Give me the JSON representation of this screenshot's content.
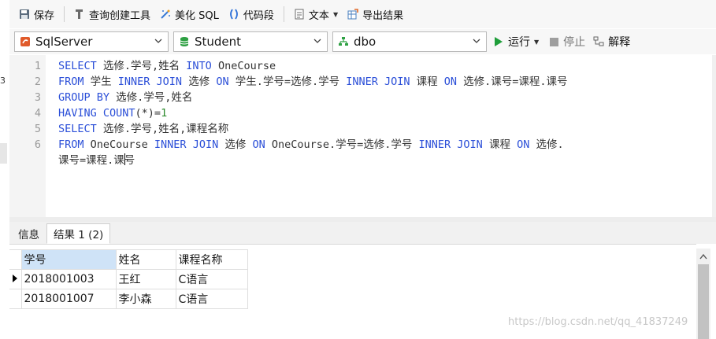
{
  "toolbar": {
    "save": "保存",
    "query_builder": "查询创建工具",
    "beautify_sql": "美化 SQL",
    "code_snippet": "代码段",
    "text": "文本",
    "export_result": "导出结果"
  },
  "selectors": {
    "connection": "SqlServer",
    "database": "Student",
    "schema": "dbo",
    "run": "运行",
    "stop": "停止",
    "explain": "解释"
  },
  "editor": {
    "line_numbers": [
      "1",
      "2",
      "3",
      "4",
      "5",
      "6"
    ],
    "lines": [
      [
        {
          "t": "kw",
          "v": "SELECT"
        },
        {
          "t": "tx",
          "v": " 选修.学号,姓名 "
        },
        {
          "t": "kw",
          "v": "INTO"
        },
        {
          "t": "tx",
          "v": " OneCourse"
        }
      ],
      [
        {
          "t": "kw",
          "v": "FROM"
        },
        {
          "t": "tx",
          "v": " 学生 "
        },
        {
          "t": "kw",
          "v": "INNER JOIN"
        },
        {
          "t": "tx",
          "v": " 选修 "
        },
        {
          "t": "kw",
          "v": "ON"
        },
        {
          "t": "tx",
          "v": " 学生.学号=选修.学号 "
        },
        {
          "t": "kw",
          "v": "INNER JOIN"
        },
        {
          "t": "tx",
          "v": " 课程 "
        },
        {
          "t": "kw",
          "v": "ON"
        },
        {
          "t": "tx",
          "v": " 选修.课号=课程.课号"
        }
      ],
      [
        {
          "t": "kw",
          "v": "GROUP BY"
        },
        {
          "t": "tx",
          "v": " 选修.学号,姓名"
        }
      ],
      [
        {
          "t": "kw",
          "v": "HAVING COUNT"
        },
        {
          "t": "tx",
          "v": "(*)="
        },
        {
          "t": "num",
          "v": "1"
        }
      ],
      [
        {
          "t": "kw",
          "v": "SELECT"
        },
        {
          "t": "tx",
          "v": " 选修.学号,姓名,课程名称"
        }
      ],
      [
        {
          "t": "kw",
          "v": "FROM"
        },
        {
          "t": "tx",
          "v": " OneCourse "
        },
        {
          "t": "kw",
          "v": "INNER JOIN"
        },
        {
          "t": "tx",
          "v": " 选修 "
        },
        {
          "t": "kw",
          "v": "ON"
        },
        {
          "t": "tx",
          "v": " OneCourse.学号=选修.学号 "
        },
        {
          "t": "kw",
          "v": "INNER JOIN"
        },
        {
          "t": "tx",
          "v": " 课程 "
        },
        {
          "t": "kw",
          "v": "ON"
        },
        {
          "t": "tx",
          "v": " 选修."
        }
      ],
      [
        {
          "t": "tx",
          "v": "课号=课程.课"
        },
        {
          "t": "cursor",
          "v": ""
        },
        {
          "t": "tx",
          "v": "号"
        }
      ]
    ]
  },
  "tabs": [
    {
      "label": "信息",
      "active": false
    },
    {
      "label": "结果 1 (2)",
      "active": true
    }
  ],
  "results": {
    "columns": [
      "学号",
      "姓名",
      "课程名称"
    ],
    "rows": [
      [
        "2018001003",
        "王红",
        "C语言"
      ],
      [
        "2018001007",
        "李小森",
        "C语言"
      ]
    ]
  },
  "watermark": "https://blog.csdn.net/qq_41837249",
  "colors": {
    "keyword": "#2b4fd8",
    "number": "#2e8b2e",
    "run_green": "#1f9e3a",
    "selected_header": "#cfe3f7"
  }
}
